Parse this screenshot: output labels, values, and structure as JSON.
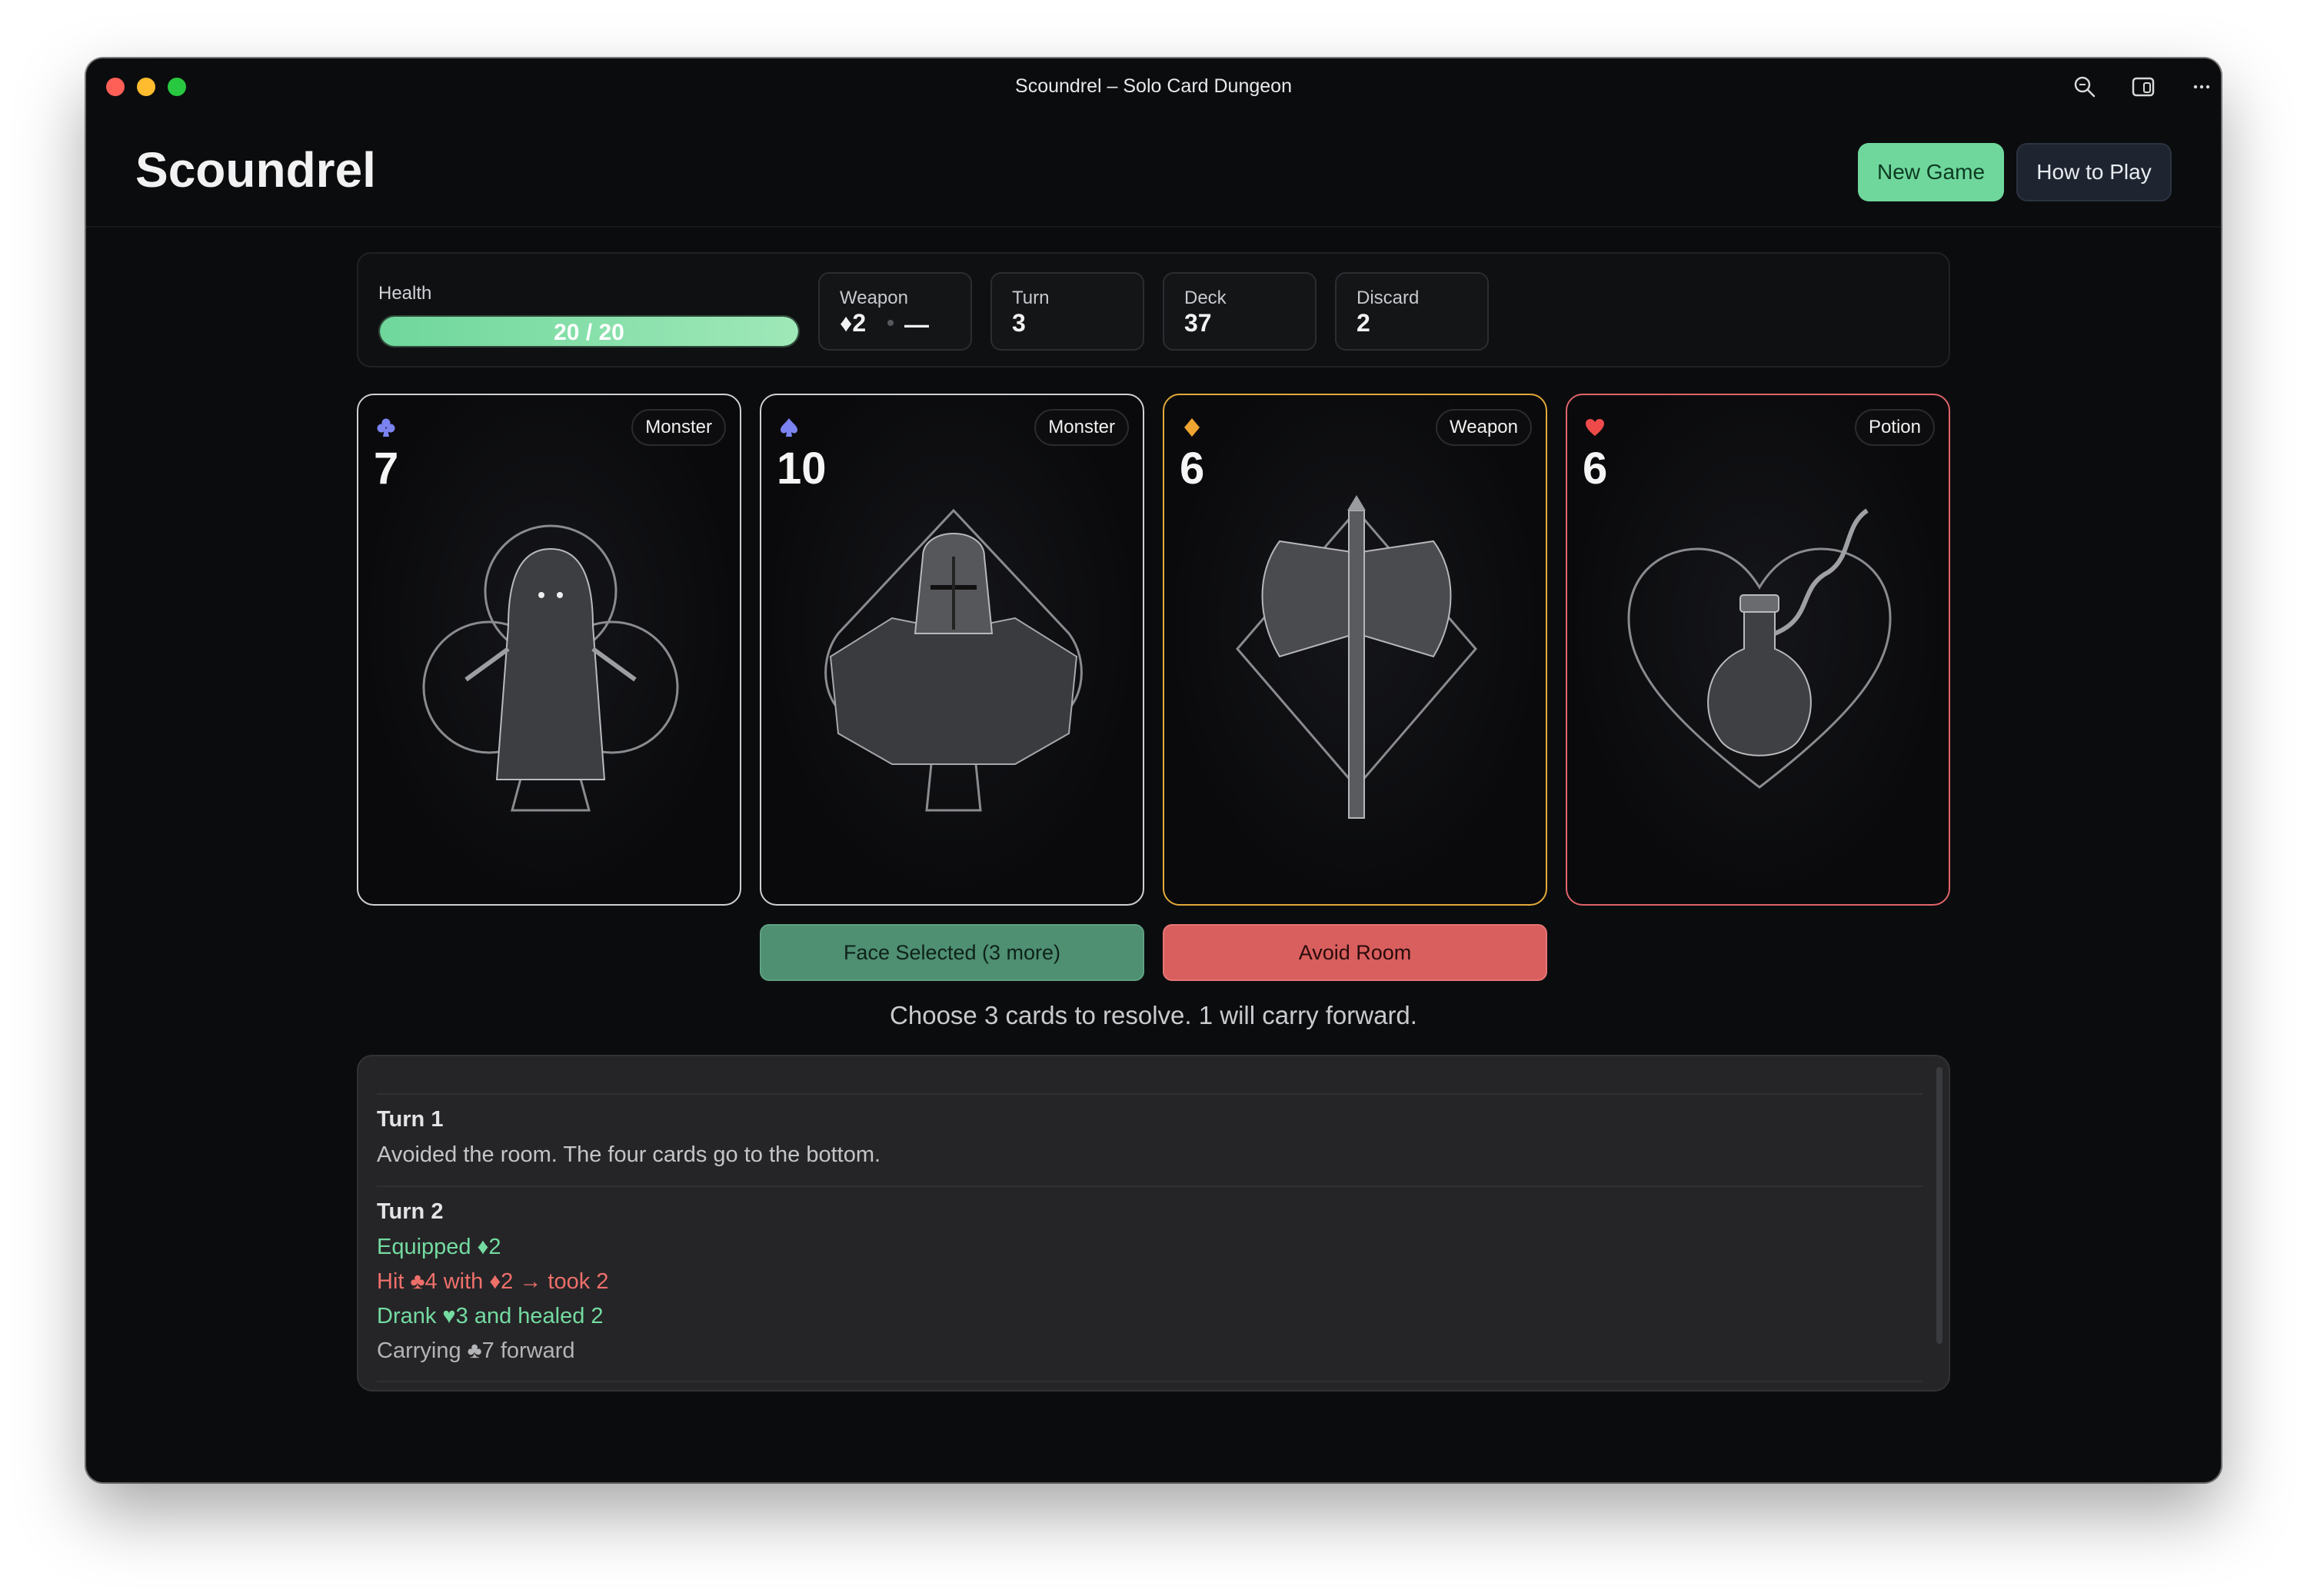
{
  "window": {
    "title": "Scoundrel – Solo Card Dungeon"
  },
  "header": {
    "app_title": "Scoundrel",
    "new_game_label": "New Game",
    "how_to_play_label": "How to Play"
  },
  "stats": {
    "health_label": "Health",
    "health_text": "20 / 20",
    "health_fraction": 1.0,
    "weapon_label": "Weapon",
    "weapon_value": "♦2",
    "weapon_last": "—",
    "turn_label": "Turn",
    "turn_value": "3",
    "deck_label": "Deck",
    "deck_value": "37",
    "discard_label": "Discard",
    "discard_value": "2"
  },
  "cards": [
    {
      "suit": "clubs",
      "rank": "7",
      "type": "Monster",
      "suit_color": "#7b83f0",
      "border": "#cfd0d4"
    },
    {
      "suit": "spades",
      "rank": "10",
      "type": "Monster",
      "suit_color": "#7b83f0",
      "border": "#cfd0d4"
    },
    {
      "suit": "diamonds",
      "rank": "6",
      "type": "Weapon",
      "suit_color": "#f0a531",
      "border": "#e2a93a"
    },
    {
      "suit": "hearts",
      "rank": "6",
      "type": "Potion",
      "suit_color": "#ef4a4a",
      "border": "#e0646a"
    }
  ],
  "actions": {
    "face_label": "Face Selected (3 more)",
    "avoid_label": "Avoid Room"
  },
  "hint": "Choose 3 cards to resolve. 1 will carry forward.",
  "log": {
    "turn1": {
      "title": "Turn 1",
      "lines": [
        "Avoided the room. The four cards go to the bottom."
      ]
    },
    "turn2": {
      "title": "Turn 2",
      "lines": [
        "Equipped ♦2",
        "Hit ♣4 with ♦2 → took 2",
        "Drank ♥3 and healed 2",
        "Carrying ♣7 forward"
      ]
    }
  }
}
